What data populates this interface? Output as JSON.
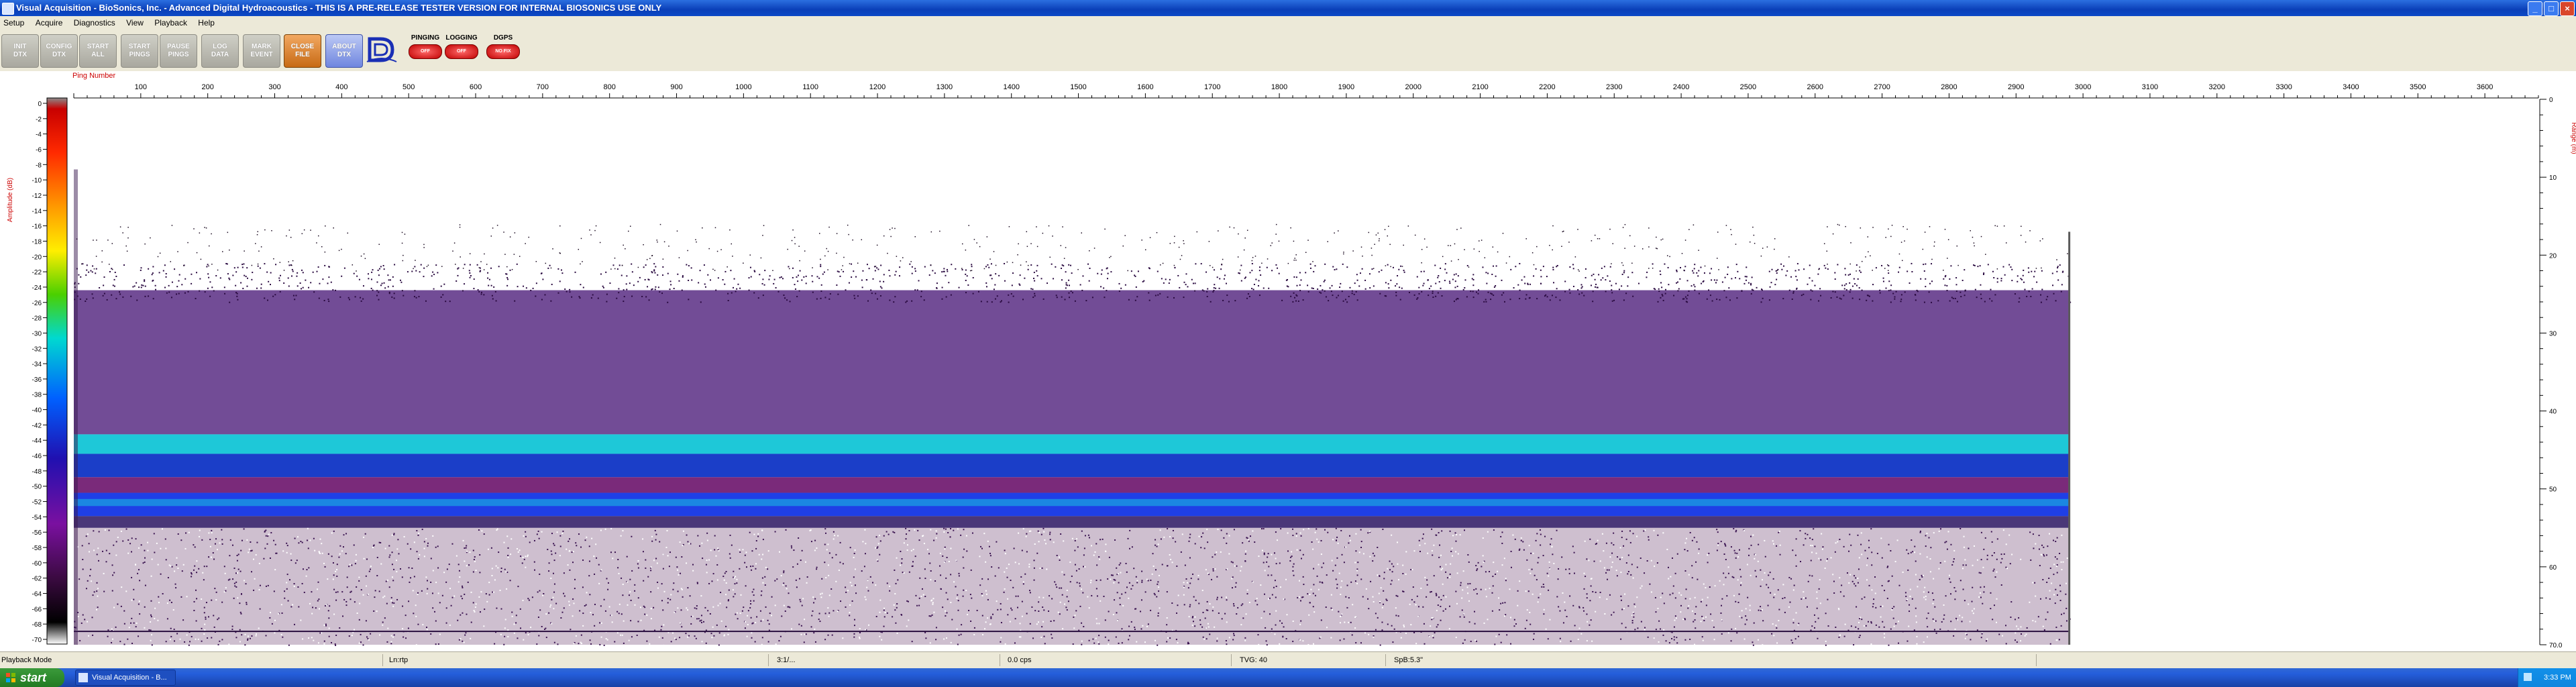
{
  "titlebar": {
    "title": "Visual Acquisition  -  BioSonics, Inc.  -  Advanced Digital Hydroacoustics  -  THIS IS A PRE-RELEASE TESTER VERSION FOR INTERNAL BIOSONICS USE ONLY"
  },
  "menu": [
    "Setup",
    "Acquire",
    "Diagnostics",
    "View",
    "Playback",
    "Help"
  ],
  "toolbar": {
    "buttons": [
      {
        "line1": "INIT",
        "line2": "DTX",
        "style": "gray"
      },
      {
        "line1": "CONFIG",
        "line2": "DTX",
        "style": "gray"
      },
      {
        "line1": "START",
        "line2": "ALL",
        "style": "gray"
      },
      {
        "line1": "START",
        "line2": "PINGS",
        "style": "gray"
      },
      {
        "line1": "PAUSE",
        "line2": "PINGS",
        "style": "gray"
      },
      {
        "line1": "LOG",
        "line2": "DATA",
        "style": "gray"
      },
      {
        "line1": "MARK",
        "line2": "EVENT",
        "style": "gray"
      },
      {
        "line1": "CLOSE",
        "line2": "FILE",
        "style": "orange"
      },
      {
        "line1": "ABOUT",
        "line2": "DTX",
        "style": "blue"
      }
    ],
    "indicators": [
      {
        "label": "PINGING",
        "state": "OFF"
      },
      {
        "label": "LOGGING",
        "state": "OFF"
      },
      {
        "label": "DGPS",
        "state": "NO FIX"
      }
    ],
    "logo_icon": "biosonics-logo-icon"
  },
  "echogram": {
    "xaxis_label": "Ping Number",
    "xticks": [
      100,
      200,
      300,
      400,
      500,
      600,
      700,
      800,
      900,
      1000,
      1100,
      1200,
      1300,
      1400,
      1500,
      1600,
      1700,
      1800,
      1900,
      2000,
      2100,
      2200,
      2300,
      2400,
      2500,
      2600,
      2700,
      2800,
      2900,
      3000,
      3100,
      3200,
      3300,
      3400,
      3500,
      3600
    ],
    "xrange": [
      0,
      3680
    ],
    "pings_recorded": 2980,
    "colorbar_label": "Amplitude (dB)",
    "colorbar_ticks": [
      0,
      -2,
      -4,
      -6,
      -8,
      -10,
      -12,
      -14,
      -16,
      -18,
      -20,
      -22,
      -24,
      -26,
      -28,
      -30,
      -32,
      -34,
      -36,
      -38,
      -40,
      -42,
      -44,
      -46,
      -48,
      -50,
      -52,
      -54,
      -56,
      -58,
      -60,
      -62,
      -64,
      -66,
      -68,
      -70
    ],
    "range_label": "Range (m)",
    "range_ticks": [
      "0",
      "10",
      "20",
      "30",
      "40",
      "50",
      "60",
      "70.0"
    ],
    "range_max": 70,
    "colors": {
      "axis_label": "#cc0000",
      "plankton": "#4a1a78",
      "band_cyan": "#1ec8d8",
      "band_blue": "#1f3fe6",
      "bottom_speckle": "#3a1350"
    }
  },
  "status": {
    "mode": "Playback Mode",
    "fields": [
      "Ln:rtp",
      "3:1/...",
      "0.0 cps",
      "TVG: 40",
      "SpB:5.3\""
    ]
  },
  "taskbar": {
    "start": "start",
    "task": "Visual Acquisition - B...",
    "clock": "3:33 PM"
  }
}
